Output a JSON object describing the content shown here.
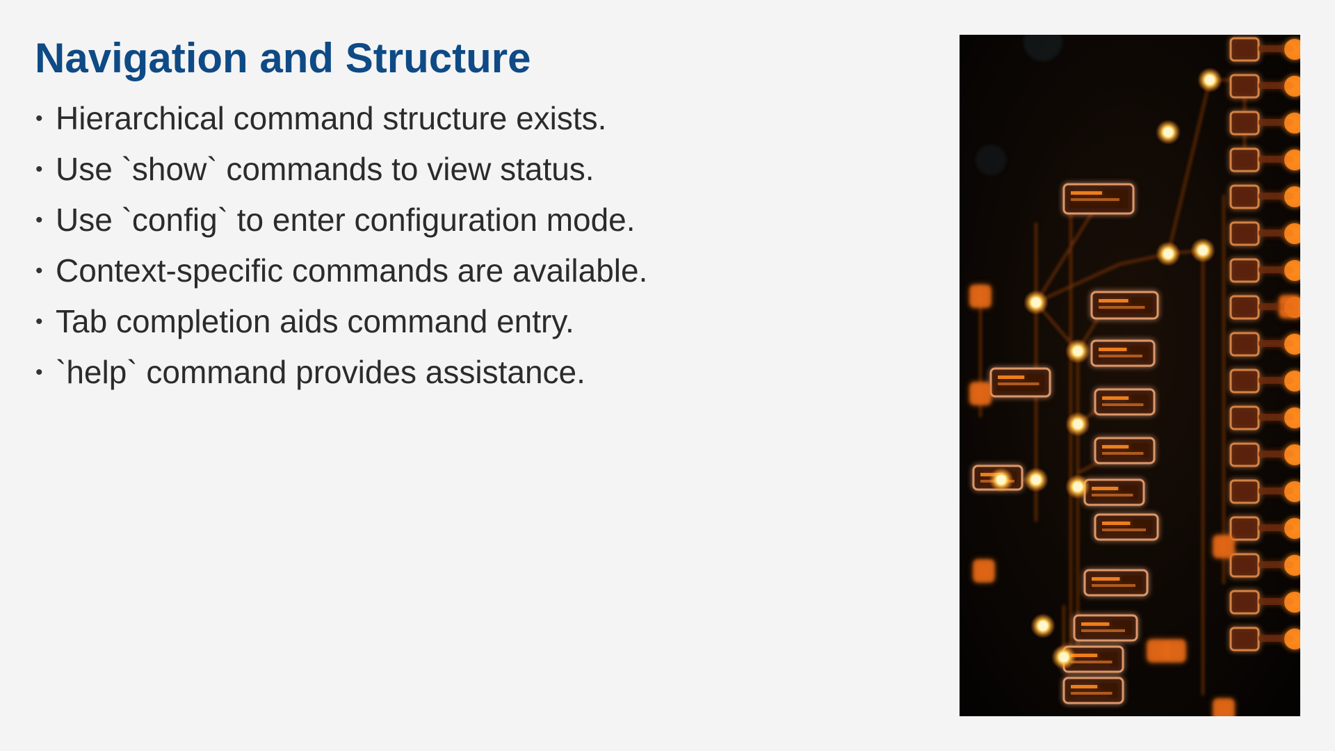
{
  "slide": {
    "title": "Navigation and Structure",
    "bullets": [
      "Hierarchical command structure exists.",
      "Use `show` commands to view status.",
      "Use `config` to enter configuration mode.",
      "Context-specific commands are available.",
      "Tab completion aids command entry.",
      "`help` command provides assistance."
    ]
  },
  "image": {
    "accent_color": "#ff8a1f"
  }
}
